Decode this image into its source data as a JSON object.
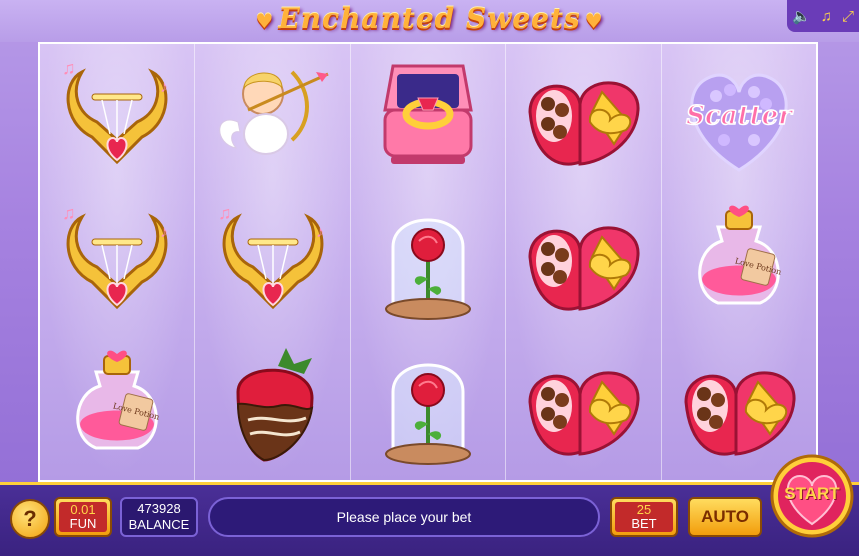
{
  "header": {
    "title": "Enchanted Sweets",
    "controls": [
      {
        "name": "sound-icon",
        "glyph": "🔈"
      },
      {
        "name": "music-icon",
        "glyph": "♫"
      },
      {
        "name": "fullscreen-icon",
        "glyph": "⤢"
      }
    ]
  },
  "reels": [
    [
      "lyre",
      "lyre",
      "love-potion"
    ],
    [
      "cupid",
      "lyre",
      "chocolate-strawberry"
    ],
    [
      "ring-box",
      "rose-dome",
      "rose-dome"
    ],
    [
      "chocolate-box",
      "chocolate-box",
      "chocolate-box"
    ],
    [
      "scatter",
      "love-potion",
      "chocolate-box"
    ]
  ],
  "scatter_text": "Scatter",
  "potion_label": "Love Potion",
  "bottom": {
    "help_label": "?",
    "coin_value": "0.01",
    "coin_label": "FUN",
    "balance_value": "473928",
    "balance_label": "BALANCE",
    "message": "Please place your bet",
    "bet_value": "25",
    "bet_label": "BET",
    "auto_label": "AUTO",
    "start_label": "START"
  }
}
